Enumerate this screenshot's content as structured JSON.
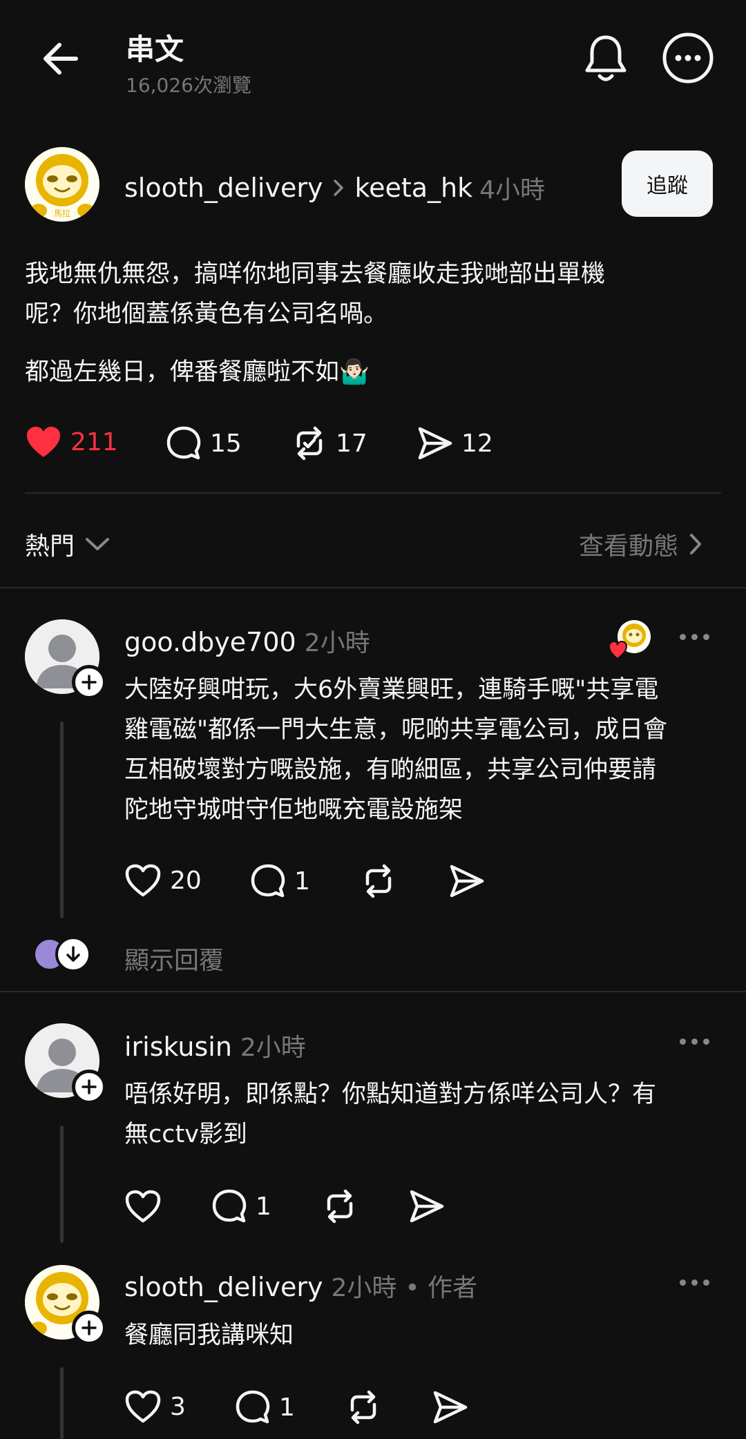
{
  "header": {
    "title": "串文",
    "views": "16,026次瀏覽"
  },
  "post": {
    "author": "slooth_delivery",
    "replied_to": "keeta_hk",
    "time": "4小時",
    "follow_label": "追蹤",
    "avatar_text": "馬拉",
    "lines": [
      "我地無仇無怨，搞咩你地同事去餐廳收走我哋部出單機",
      "呢？你地個蓋係黃色有公司名喎。",
      "都過左幾日，俾番餐廳啦不如🤷🏻‍♂️"
    ],
    "likes": "211",
    "comments": "15",
    "reposts": "17",
    "shares": "12"
  },
  "sort": {
    "label": "熱門",
    "activity_label": "查看動態"
  },
  "replies": [
    {
      "author": "goo.dbye700",
      "time": "2小時",
      "lines": [
        "大陸好興咁玩，大6外賣業興旺，連騎手嘅\"共享電",
        "雞電磁\"都係一門大生意，呢啲共享電公司，成日會",
        "互相破壞對方嘅設施，有啲細區，共享公司仲要請",
        "陀地守城咁守佢地嘅充電設施架"
      ],
      "likes": "20",
      "comments": "1",
      "show_replies": "顯示回覆"
    },
    {
      "author": "iriskusin",
      "time": "2小時",
      "lines": [
        "唔係好明，即係點？你點知道對方係咩公司人？有",
        "無cctv影到"
      ],
      "comments": "1"
    },
    {
      "author": "slooth_delivery",
      "time": "2小時",
      "author_tag": "• 作者",
      "lines": [
        "餐廳同我講咪知"
      ],
      "likes": "3",
      "comments": "1"
    }
  ],
  "colors": {
    "background": "#101010",
    "like_red": "#ff3040",
    "muted": "#777777",
    "sloth_yellow": "#e8b400"
  }
}
